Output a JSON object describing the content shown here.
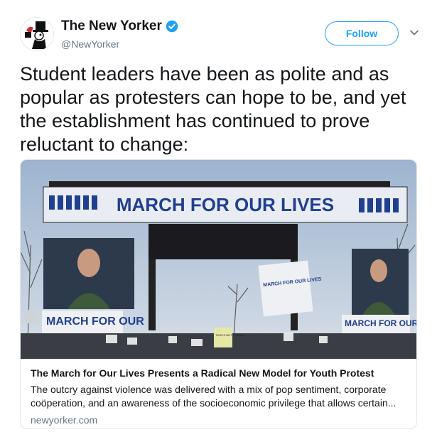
{
  "account": {
    "display_name": "The New Yorker",
    "handle": "@NewYorker",
    "verified": true,
    "avatar_icon": "new-yorker-eustace-logo-icon"
  },
  "follow_label": "Follow",
  "tweet": {
    "text": "Student leaders have been as polite and as popular as protesters can hope to be, and yet the establishment has continued to prove reluctant to change:"
  },
  "card": {
    "image": {
      "banner_text": "MARCH FOR OUR LIVES",
      "left_sign": "MARCH FOR OUR",
      "center_sign": "MARCH FOR OUR LIVES",
      "right_sign": "MARCH FOR OUR",
      "crowd_sign": "THIS IS NOT NORMAL"
    },
    "title": "The March for Our Lives Presents a Radical New Model for Youth Protest",
    "description": "The outcry against violence was delivered with a mix of pop sentiment, corporate coöperation, and an awareness of the socioeconomic privilege that allows certain...",
    "domain": "newyorker.com"
  },
  "colors": {
    "accent": "#1da1f2",
    "secondary_text": "#657786",
    "border": "#e1e8ed",
    "banner_blue": "#1f3f8f"
  }
}
